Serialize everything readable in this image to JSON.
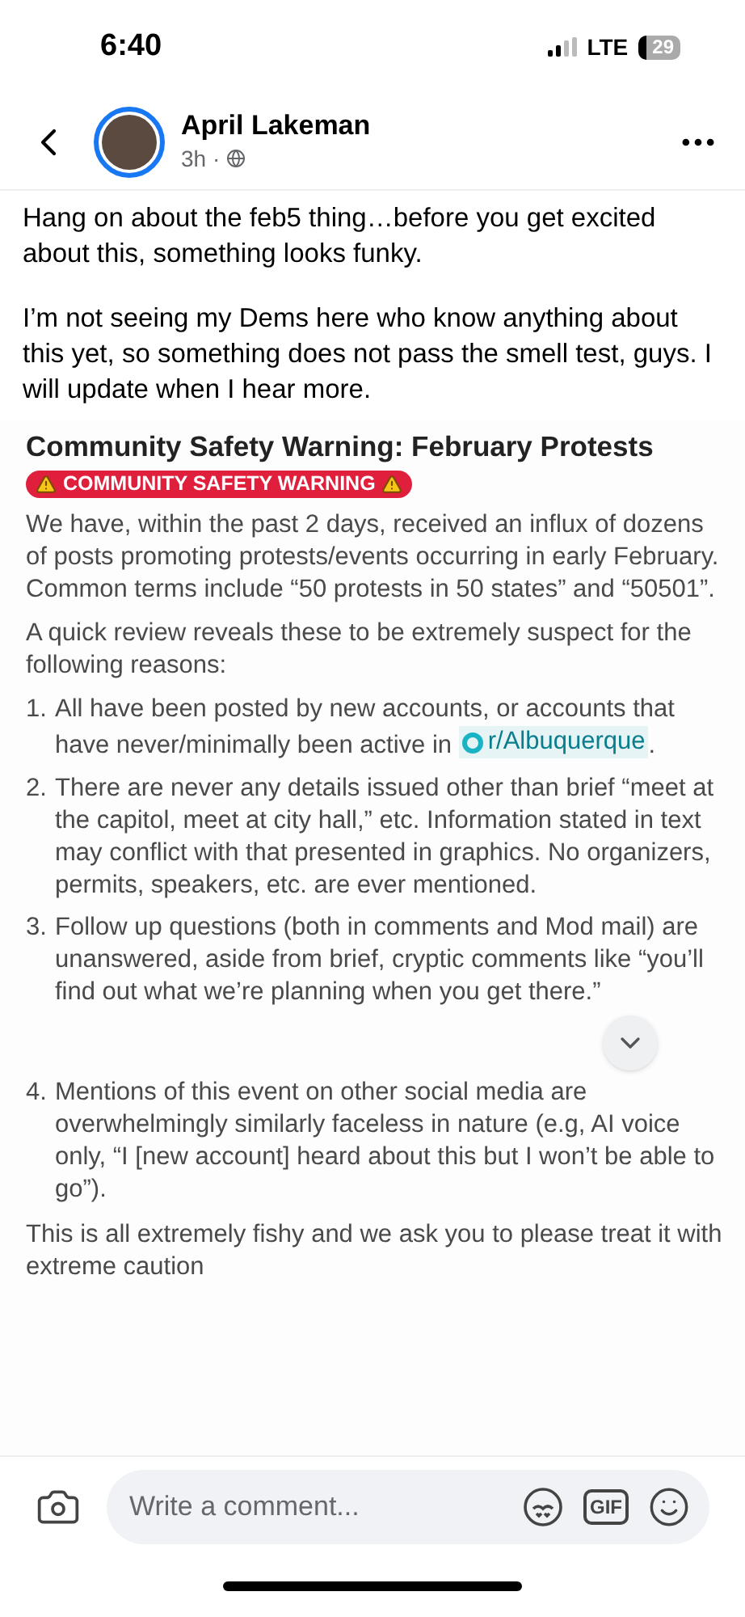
{
  "status_bar": {
    "time": "6:40",
    "network": "LTE",
    "battery": "29"
  },
  "post": {
    "author": "April Lakeman",
    "time": "3h",
    "time_separator": "·",
    "body": [
      "Hang on about the feb5 thing…before you get excited about this, something looks funky.",
      "I’m not seeing my Dems here who know anything about this yet, so something does not pass the smell test, guys. I will update when I hear more."
    ]
  },
  "shared_image": {
    "title": "Community Safety Warning: February Protests",
    "badge": "COMMUNITY SAFETY WARNING",
    "paragraphs": [
      "We have, within the past 2 days, received an influx of dozens of posts promoting protests/events occurring in early February. Common terms include “50 protests in 50 states” and “50501”.",
      "A quick review reveals these to be extremely suspect for the following reasons:"
    ],
    "reasons": [
      {
        "number": "1.",
        "text": "All have been posted by new accounts, or accounts that have never/minimally been active in",
        "link": "r/Albuquerque",
        "after_link": "."
      },
      {
        "number": "2.",
        "text": "There are never any details issued other than brief “meet at the capitol, meet at city hall,” etc. Information stated in text may conflict with that presented in graphics. No organizers, permits, speakers, etc. are ever mentioned."
      },
      {
        "number": "3.",
        "text": "Follow up questions (both in comments and Mod mail) are unanswered, aside from brief, cryptic comments like “you’ll find out what we’re planning when you get there.”"
      },
      {
        "number": "4.",
        "text": "Mentions of this event on other social media are overwhelmingly similarly faceless in nature (e.g, AI voice only, “I [new account] heard about this but I won’t be able to go”)."
      }
    ],
    "closing": "This is all extremely fishy and we ask you to please treat it with extreme caution"
  },
  "comment_bar": {
    "placeholder": "Write a comment...",
    "gif_label": "GIF"
  }
}
